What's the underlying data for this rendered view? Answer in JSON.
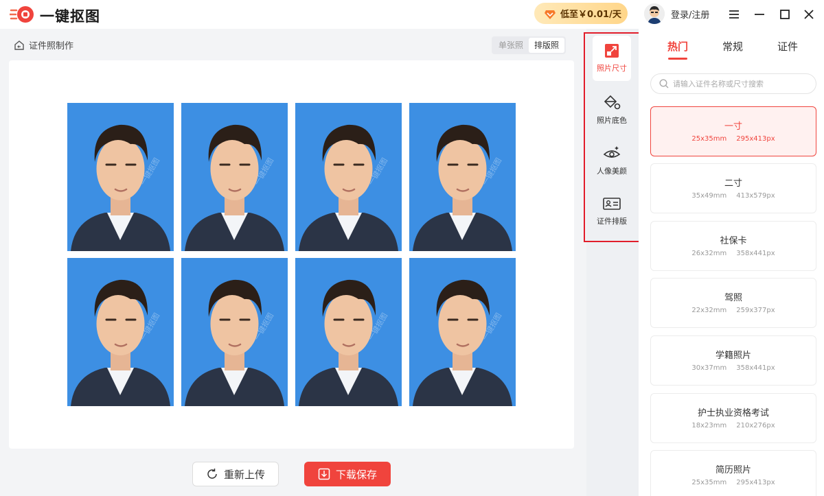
{
  "app": {
    "title": "一键抠图"
  },
  "promo": {
    "text": "低至￥0.01/天"
  },
  "user": {
    "login_label": "登录/注册"
  },
  "workspace": {
    "breadcrumb": "证件照制作",
    "modes": [
      "单张照",
      "排版照"
    ],
    "active_mode": "排版照",
    "photo_grid": {
      "rows": 2,
      "cols": 4,
      "watermark": "一键抠图"
    },
    "reupload_label": "重新上传",
    "download_label": "下载保存"
  },
  "tools": [
    {
      "label": "照片尺寸",
      "icon": "photo-size-icon",
      "active": true
    },
    {
      "label": "照片底色",
      "icon": "paint-bucket-icon",
      "active": false
    },
    {
      "label": "人像美颜",
      "icon": "beauty-eye-icon",
      "active": false
    },
    {
      "label": "证件排版",
      "icon": "id-card-icon",
      "active": false
    }
  ],
  "panel": {
    "tabs": [
      "热门",
      "常规",
      "证件"
    ],
    "active_tab": "热门",
    "search_placeholder": "请输入证件名称或尺寸搜索",
    "sizes": [
      {
        "name": "一寸",
        "mm": "25x35mm",
        "px": "295x413px",
        "selected": true
      },
      {
        "name": "二寸",
        "mm": "35x49mm",
        "px": "413x579px"
      },
      {
        "name": "社保卡",
        "mm": "26x32mm",
        "px": "358x441px"
      },
      {
        "name": "驾照",
        "mm": "22x32mm",
        "px": "259x377px"
      },
      {
        "name": "学籍照片",
        "mm": "30x37mm",
        "px": "358x441px"
      },
      {
        "name": "护士执业资格考试",
        "mm": "18x23mm",
        "px": "210x276px"
      },
      {
        "name": "简历照片",
        "mm": "25x35mm",
        "px": "295x413px"
      }
    ]
  },
  "colors": {
    "accent": "#f0443d",
    "photo_bg": "#3d8fe3",
    "highlight": "#e11d2a"
  }
}
